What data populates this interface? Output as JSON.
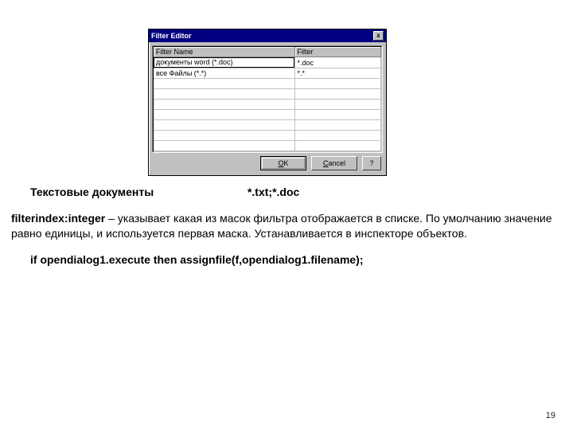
{
  "dialog": {
    "title": "Filter Editor",
    "close": "x",
    "columns": {
      "name": "Filter Name",
      "filter": "Filter"
    },
    "rows": [
      {
        "name": "документы word (*.doc)",
        "filter": "*.doc",
        "editing": true
      },
      {
        "name": "все Файлы (*.*)",
        "filter": "*.*",
        "editing": false
      }
    ],
    "buttons": {
      "ok": "OK",
      "cancel": "Cancel",
      "help": "?"
    }
  },
  "text": {
    "line1_label": "Текстовые документы",
    "line1_value": "*.txt;*.doc",
    "para_lead": "filterindex:integer",
    "para_body1": " – указывает какая из масок фильтра отображается в списке. По умолчанию значение равно единицы, и используется первая маска. Устанавливается в инспекторе объектов.",
    "code": "if opendialog1.execute then  assignfile(f,opendialog1.filename);"
  },
  "page": "19"
}
